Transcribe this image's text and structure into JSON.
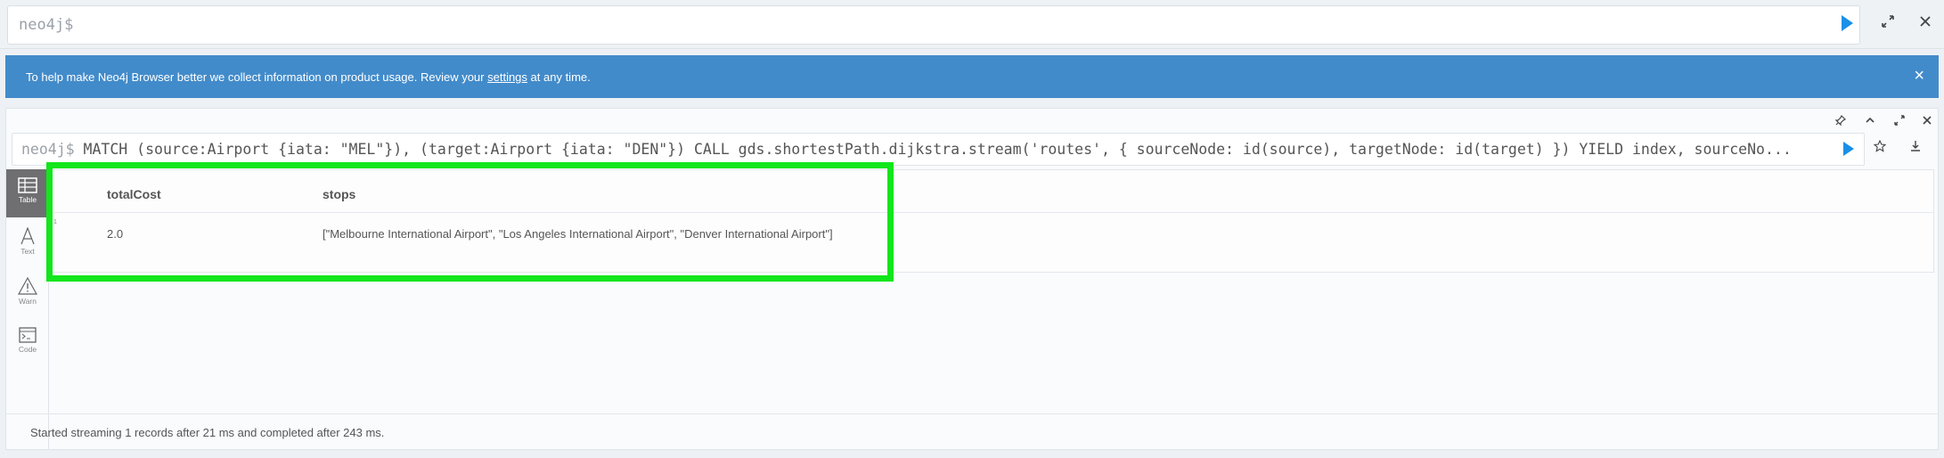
{
  "editor": {
    "prompt": "neo4j$"
  },
  "banner": {
    "text_before": "To help make Neo4j Browser better we collect information on product usage. Review your",
    "link": "settings",
    "text_after": "at any time.",
    "close": "×"
  },
  "frame": {
    "prompt": "neo4j$",
    "query": "MATCH (source:Airport {iata: \"MEL\"}), (target:Airport {iata: \"DEN\"}) CALL gds.shortestPath.dijkstra.stream('routes', { sourceNode: id(source), targetNode: id(target) }) YIELD index, sourceNo..."
  },
  "side_tabs": [
    {
      "label": "Table",
      "icon": "table-icon"
    },
    {
      "label": "Text",
      "icon": "text-icon"
    },
    {
      "label": "Warn",
      "icon": "warning-icon"
    },
    {
      "label": "Code",
      "icon": "code-icon"
    }
  ],
  "table": {
    "columns": [
      "totalCost",
      "stops"
    ],
    "rows": [
      {
        "num": "1",
        "totalCost": "2.0",
        "stops": "[\"Melbourne International Airport\", \"Los Angeles International Airport\", \"Denver International Airport\"]"
      }
    ]
  },
  "status": "Started streaming 1 records after 21 ms and completed after 243 ms.",
  "colors": {
    "banner": "#428bca",
    "play": "#1a8fe8",
    "highlight": "#12e61c"
  }
}
